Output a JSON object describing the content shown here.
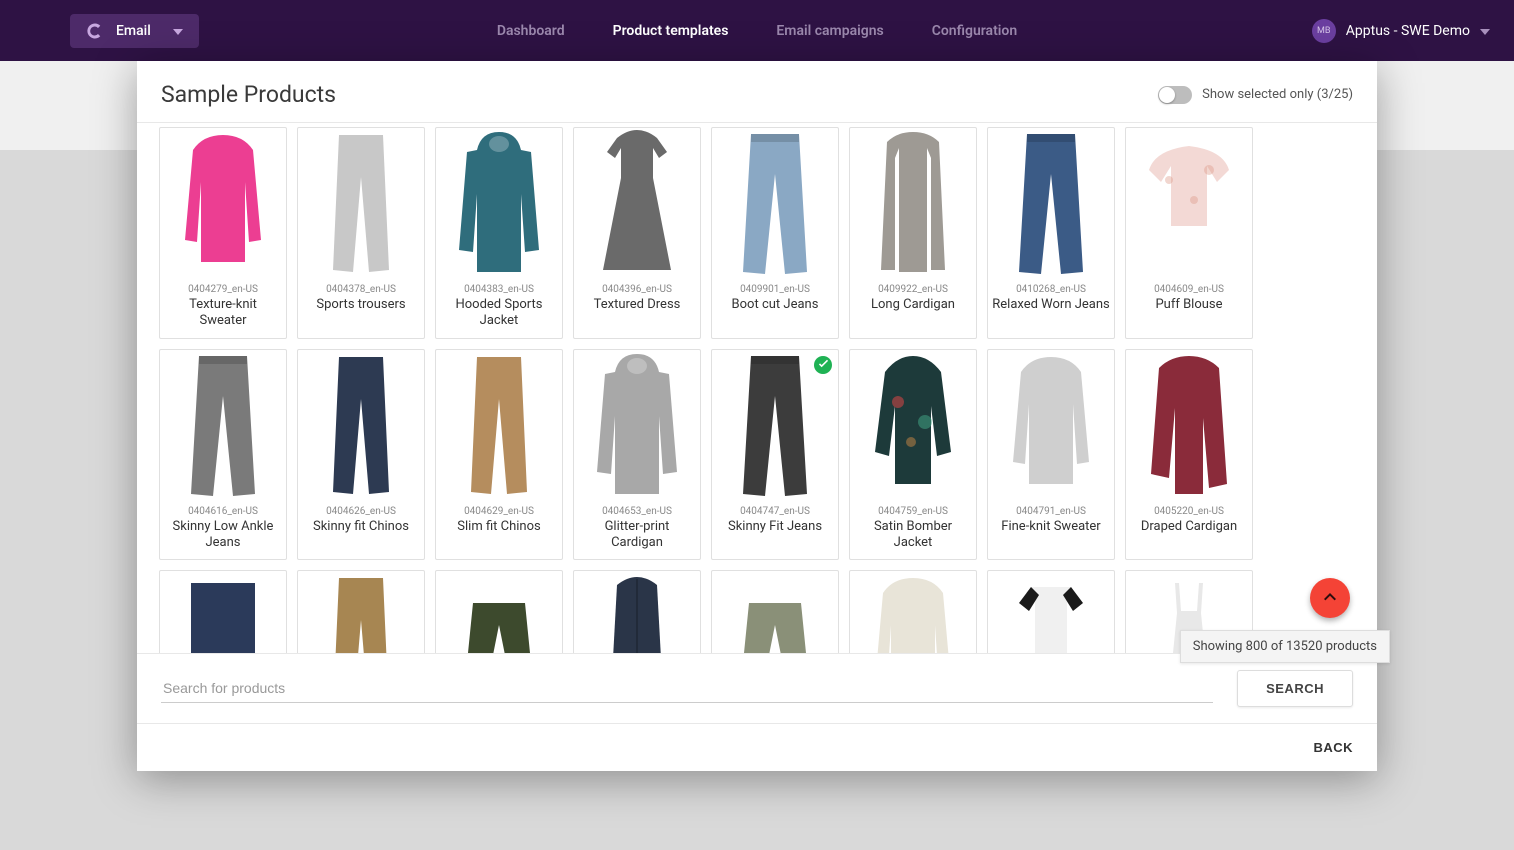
{
  "topbar": {
    "email_label": "Email",
    "tabs": [
      "Dashboard",
      "Product templates",
      "Email campaigns",
      "Configuration"
    ],
    "active_tab_index": 1,
    "user_initials": "MB",
    "user_label": "Apptus - SWE Demo"
  },
  "modal": {
    "title": "Sample Products",
    "toggle_label": "Show selected only (3/25)",
    "search_placeholder": "Search for products",
    "search_button": "SEARCH",
    "back_button": "BACK",
    "counter_text": "Showing 800 of 13520 products"
  },
  "products": [
    {
      "sku": "0404279_en-US",
      "name": "Texture-knit Sweater",
      "selected": false,
      "svg": "sweater",
      "color": "#ec3e92"
    },
    {
      "sku": "0404378_en-US",
      "name": "Sports trousers",
      "selected": false,
      "svg": "trousers",
      "color": "#c8c8c8"
    },
    {
      "sku": "0404383_en-US",
      "name": "Hooded Sports Jacket",
      "selected": false,
      "svg": "hoodie",
      "color": "#2f6d7c"
    },
    {
      "sku": "0404396_en-US",
      "name": "Textured Dress",
      "selected": false,
      "svg": "dress",
      "color": "#6a6a6a"
    },
    {
      "sku": "0409901_en-US",
      "name": "Boot cut Jeans",
      "selected": false,
      "svg": "jeans",
      "color": "#8aa8c4"
    },
    {
      "sku": "0409922_en-US",
      "name": "Long Cardigan",
      "selected": false,
      "svg": "cardigan-long",
      "color": "#9e9a94"
    },
    {
      "sku": "0410268_en-US",
      "name": "Relaxed Worn Jeans",
      "selected": false,
      "svg": "jeans",
      "color": "#3b5b86"
    },
    {
      "sku": "0404609_en-US",
      "name": "Puff Blouse",
      "selected": false,
      "svg": "blouse",
      "color": "#f3d9d5"
    },
    {
      "sku": "0404616_en-US",
      "name": "Skinny Low Ankle Jeans",
      "selected": false,
      "svg": "jeans",
      "color": "#7a7a7a"
    },
    {
      "sku": "0404626_en-US",
      "name": "Skinny fit Chinos",
      "selected": false,
      "svg": "trousers",
      "color": "#2d3a52"
    },
    {
      "sku": "0404629_en-US",
      "name": "Slim fit Chinos",
      "selected": false,
      "svg": "trousers",
      "color": "#b58d5e"
    },
    {
      "sku": "0404653_en-US",
      "name": "Glitter-print Cardigan",
      "selected": false,
      "svg": "hoodie",
      "color": "#a8a8a8"
    },
    {
      "sku": "0404747_en-US",
      "name": "Skinny Fit Jeans",
      "selected": true,
      "svg": "jeans",
      "color": "#3c3c3c"
    },
    {
      "sku": "0404759_en-US",
      "name": "Satin Bomber Jacket",
      "selected": false,
      "svg": "bomber",
      "color": "#1d3a3a"
    },
    {
      "sku": "0404791_en-US",
      "name": "Fine-knit Sweater",
      "selected": false,
      "svg": "sweater",
      "color": "#cfcfcf"
    },
    {
      "sku": "0405220_en-US",
      "name": "Draped Cardigan",
      "selected": false,
      "svg": "cardigan",
      "color": "#8a2b3a"
    },
    {
      "sku": "",
      "name": "",
      "selected": false,
      "svg": "rect",
      "color": "#2b3a5a"
    },
    {
      "sku": "",
      "name": "",
      "selected": false,
      "svg": "trousers",
      "color": "#a78652"
    },
    {
      "sku": "",
      "name": "",
      "selected": false,
      "svg": "shorts",
      "color": "#3d4a2d"
    },
    {
      "sku": "",
      "name": "",
      "selected": false,
      "svg": "vest",
      "color": "#2a3548"
    },
    {
      "sku": "",
      "name": "",
      "selected": false,
      "svg": "shorts",
      "color": "#8a9078"
    },
    {
      "sku": "",
      "name": "",
      "selected": false,
      "svg": "sweater",
      "color": "#e8e4d8"
    },
    {
      "sku": "",
      "name": "",
      "selected": false,
      "svg": "raglan",
      "color": "#f0f0f0"
    },
    {
      "sku": "",
      "name": "",
      "selected": false,
      "svg": "cami",
      "color": "#e8e8e8"
    }
  ]
}
